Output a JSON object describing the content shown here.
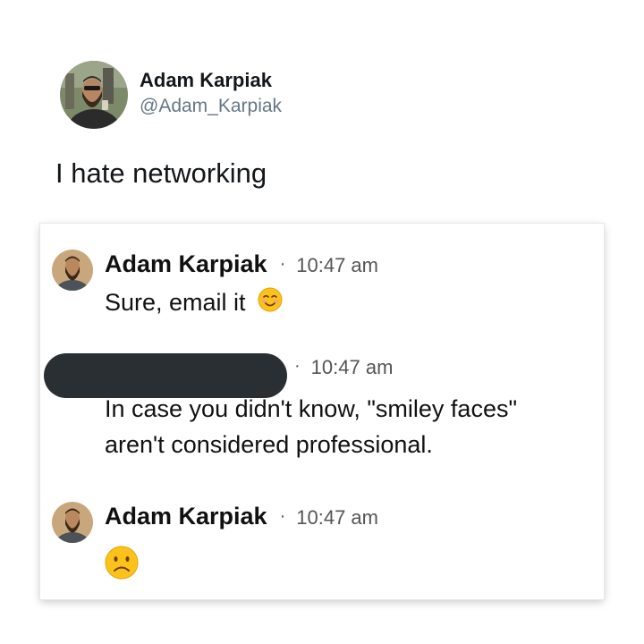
{
  "tweet": {
    "author_name": "Adam Karpiak",
    "author_handle": "@Adam_Karpiak",
    "text": "I hate networking"
  },
  "chat": {
    "messages": [
      {
        "sender": "Adam Karpiak",
        "separator": "·",
        "time": "10:47 am",
        "text": "Sure, email it",
        "emoji": "smiling-face-icon"
      },
      {
        "sender": "",
        "sender_redacted": true,
        "separator": "·",
        "time": "10:47 am",
        "text_line1": "In case you didn't know, \"smiley faces\"",
        "text_line2": "aren't considered professional."
      },
      {
        "sender": "Adam Karpiak",
        "separator": "·",
        "time": "10:47 am",
        "emoji": "frowning-face-icon"
      }
    ]
  },
  "colors": {
    "handle": "#657786",
    "redaction": "#2a2f33",
    "emoji_yellow": "#fcc21b"
  }
}
